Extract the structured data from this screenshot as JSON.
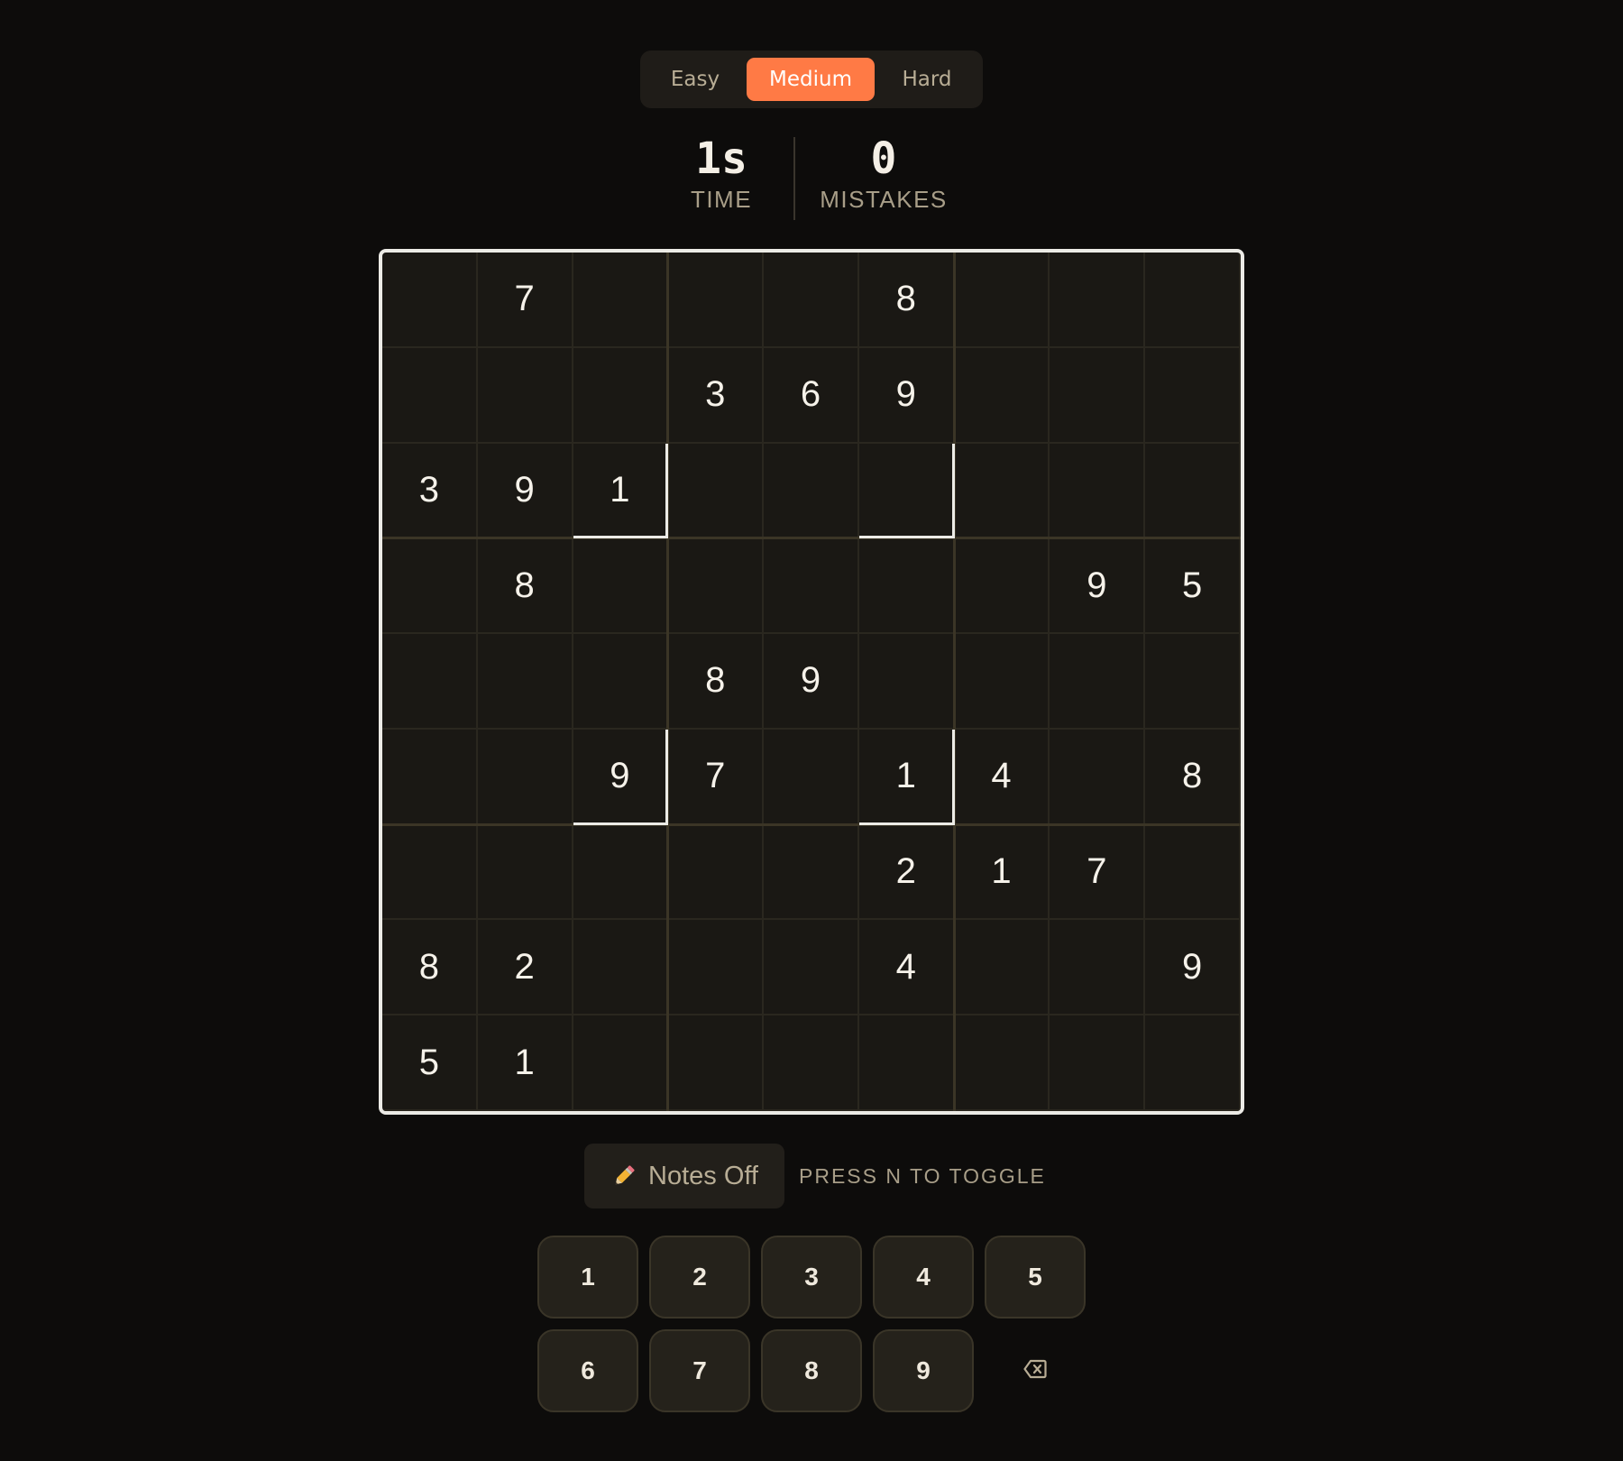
{
  "colors": {
    "accent": "#ff7a45",
    "background": "#0d0c0b",
    "panel": "#1f1c18",
    "board_bg": "#1a1814",
    "cell_text": "#f6f2ea",
    "muted_text": "#a89e88"
  },
  "difficulty": {
    "options": [
      "Easy",
      "Medium",
      "Hard"
    ],
    "selected": "Medium"
  },
  "stats": {
    "time_value": "1s",
    "time_label": "TIME",
    "mistakes_value": "0",
    "mistakes_label": "MISTAKES"
  },
  "board": {
    "cells": [
      [
        "",
        "7",
        "",
        "",
        "",
        "8",
        "",
        "",
        ""
      ],
      [
        "",
        "",
        "",
        "3",
        "6",
        "9",
        "",
        "",
        ""
      ],
      [
        "3",
        "9",
        "1",
        "",
        "",
        "",
        "",
        "",
        ""
      ],
      [
        "",
        "8",
        "",
        "",
        "",
        "",
        "",
        "9",
        "5"
      ],
      [
        "",
        "",
        "",
        "8",
        "9",
        "",
        "",
        "",
        ""
      ],
      [
        "",
        "",
        "9",
        "7",
        "",
        "1",
        "4",
        "",
        "8"
      ],
      [
        "",
        "",
        "",
        "",
        "",
        "2",
        "1",
        "7",
        ""
      ],
      [
        "8",
        "2",
        "",
        "",
        "",
        "4",
        "",
        "",
        "9"
      ],
      [
        "5",
        "1",
        "",
        "",
        "",
        "",
        "",
        "",
        ""
      ]
    ]
  },
  "notes": {
    "icon": "pencil-icon",
    "label": "Notes Off",
    "hint": "PRESS N TO TOGGLE"
  },
  "numpad": {
    "keys": [
      "1",
      "2",
      "3",
      "4",
      "5",
      "6",
      "7",
      "8",
      "9"
    ],
    "erase_icon": "backspace-icon"
  }
}
